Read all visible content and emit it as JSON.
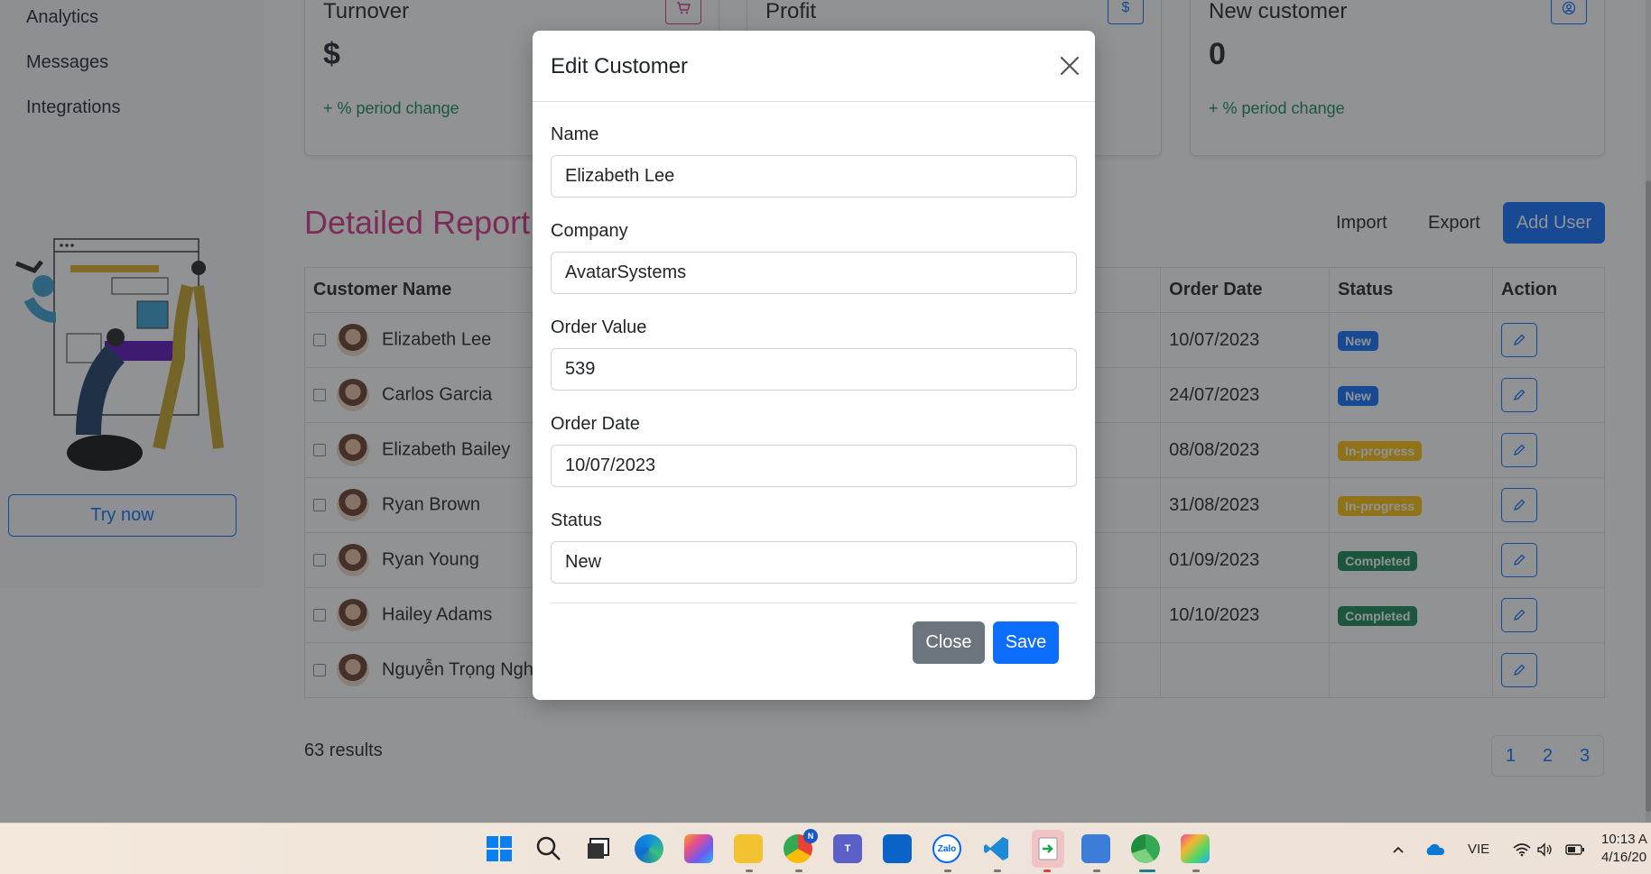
{
  "sidebar": {
    "items": [
      {
        "label": "Analytics"
      },
      {
        "label": "Messages"
      },
      {
        "label": "Integrations"
      }
    ],
    "try_now": "Try now"
  },
  "cards": [
    {
      "title": "Turnover",
      "value": "$",
      "change": "+ % period change",
      "icon": "cart-icon"
    },
    {
      "title": "Profit",
      "value": "",
      "change": "",
      "icon": "dollar-icon"
    },
    {
      "title": "New customer",
      "value": "0",
      "change": "+ % period change",
      "icon": "user-circle-icon"
    }
  ],
  "report": {
    "title": "Detailed Report",
    "import_label": "Import",
    "export_label": "Export",
    "add_user_label": "Add User",
    "columns": {
      "customer_name": "Customer Name",
      "order_date": "Order Date",
      "status": "Status",
      "action": "Action"
    },
    "rows": [
      {
        "name": "Elizabeth Lee",
        "date": "10/07/2023",
        "status": "New"
      },
      {
        "name": "Carlos Garcia",
        "date": "24/07/2023",
        "status": "New"
      },
      {
        "name": "Elizabeth Bailey",
        "date": "08/08/2023",
        "status": "In-progress"
      },
      {
        "name": "Ryan Brown",
        "date": "31/08/2023",
        "status": "In-progress"
      },
      {
        "name": "Ryan Young",
        "date": "01/09/2023",
        "status": "Completed"
      },
      {
        "name": "Hailey Adams",
        "date": "10/10/2023",
        "status": "Completed"
      },
      {
        "name": "Nguyễn Trọng Ngh",
        "date": "",
        "status": ""
      }
    ],
    "results": "63 results",
    "pages": [
      "1",
      "2",
      "3"
    ]
  },
  "modal": {
    "title": "Edit Customer",
    "fields": {
      "name": {
        "label": "Name",
        "value": "Elizabeth Lee"
      },
      "company": {
        "label": "Company",
        "value": "AvatarSystems"
      },
      "order_value": {
        "label": "Order Value",
        "value": "539"
      },
      "order_date": {
        "label": "Order Date",
        "value": "10/07/2023"
      },
      "status": {
        "label": "Status",
        "value": "New"
      }
    },
    "close_label": "Close",
    "save_label": "Save"
  },
  "taskbar": {
    "apps": [
      "windows-start",
      "search",
      "task-view",
      "edge",
      "copilot",
      "file-explorer",
      "chrome",
      "teams",
      "outlook",
      "zalo",
      "vscode",
      "app-green",
      "notepad",
      "app-chrome-alt",
      "app-colorful"
    ],
    "zalo_label": "Zalo",
    "teams_label": "T",
    "chrome_badge": "N",
    "lang": "VIE",
    "time": "10:13 A",
    "date": "4/16/20"
  },
  "colors": {
    "accent": "#0d6efd",
    "title_pink": "#d63384",
    "success": "#198754",
    "warning": "#ffc107",
    "secondary": "#6c757d"
  }
}
